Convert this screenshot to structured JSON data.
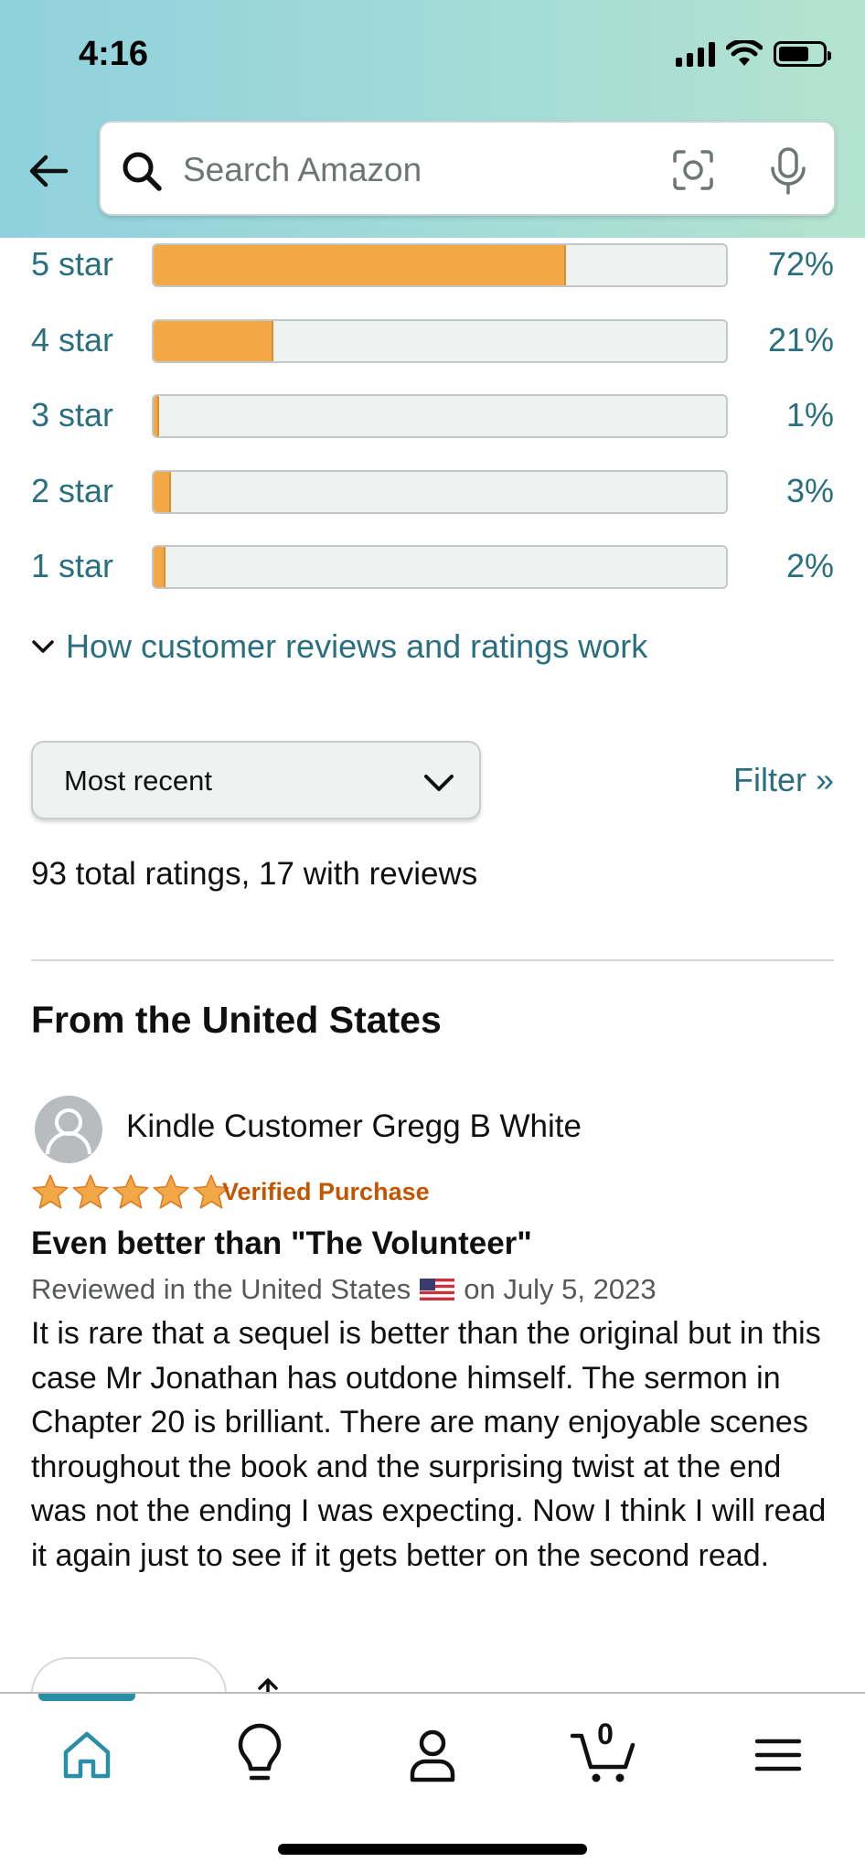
{
  "status_bar": {
    "time": "4:16"
  },
  "header": {
    "search_placeholder": "Search Amazon"
  },
  "histogram": [
    {
      "label": "5 star",
      "percent_text": "72%",
      "fill": 0.72
    },
    {
      "label": "4 star",
      "percent_text": "21%",
      "fill": 0.21
    },
    {
      "label": "3 star",
      "percent_text": "1%",
      "fill": 0.01
    },
    {
      "label": "2 star",
      "percent_text": "3%",
      "fill": 0.03
    },
    {
      "label": "1 star",
      "percent_text": "2%",
      "fill": 0.02
    }
  ],
  "how_reviews_link": "How customer reviews and ratings work",
  "sort": {
    "selected": "Most recent"
  },
  "filter_link": "Filter »",
  "total_ratings_text": "93 total ratings, 17 with reviews",
  "section_title": "From the United States",
  "review": {
    "reviewer": "Kindle Customer Gregg B White",
    "rating": 5,
    "verified": "Verified Purchase",
    "title": "Even better than \"The Volunteer\"",
    "meta_prefix": "Reviewed in the United States",
    "meta_date": "on July 5, 2023",
    "body": "It is rare that a sequel is better than the original but in this case Mr Jonathan has outdone himself. The sermon in Chapter 20 is brilliant. There are many enjoyable scenes throughout the book and the surprising twist at the end was not the ending I was expecting. Now I think I will read it again just to see if it gets better on the second read."
  },
  "bottom_nav": {
    "items": [
      "home-icon",
      "lightbulb-icon",
      "account-icon",
      "cart-icon",
      "menu-icon"
    ],
    "cart_count": "0",
    "active": "home"
  },
  "colors": {
    "link": "#2a6f80",
    "bar_fill": "#f3a847",
    "verified": "#c45500",
    "header_gradient_start": "#8fd1dd",
    "header_gradient_end": "#b4e3cf"
  }
}
